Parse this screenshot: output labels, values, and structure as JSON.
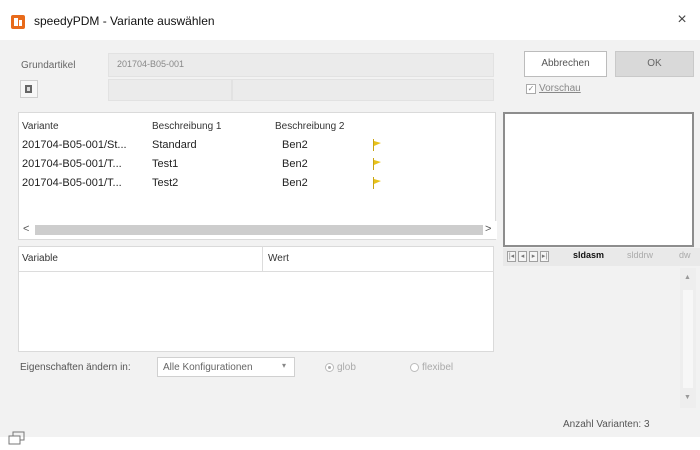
{
  "window": {
    "title": "speedyPDM - Variante auswählen",
    "close_glyph": "×",
    "app_icon": "speedypdm-logo-icon"
  },
  "grundartikel": {
    "label": "Grundartikel",
    "value": "201704-B05-001"
  },
  "buttons": {
    "cancel": "Abbrechen",
    "ok": "OK"
  },
  "preview_checkbox": {
    "label": "Vorschau",
    "checked": true
  },
  "variants_list": {
    "headers": [
      "Variante",
      "Beschreibung 1",
      "Beschreibung 2"
    ],
    "rows": [
      {
        "variante": "201704-B05-001/St...",
        "beschreibung1": "Standard",
        "beschreibung2": "Ben2"
      },
      {
        "variante": "201704-B05-001/T...",
        "beschreibung1": "Test1",
        "beschreibung2": "Ben2"
      },
      {
        "variante": "201704-B05-001/T...",
        "beschreibung1": "Test2",
        "beschreibung2": "Ben2"
      }
    ],
    "scroll_left": "<",
    "scroll_right": ">"
  },
  "properties_grid": {
    "headers": [
      "Variable",
      "Wert"
    ]
  },
  "bottom_bar": {
    "label": "Eigenschaften ändern in:",
    "select_value": "Alle Konfigurationen",
    "radio_1": "glob",
    "radio_2": "flexibel"
  },
  "preview_tabs": {
    "tabs": [
      "sldasm",
      "slddrw",
      "dw"
    ],
    "active_index": 0
  },
  "status": {
    "text": "Anzahl Varianten: 3"
  },
  "colors": {
    "dialog_bg": "#f2f2f2",
    "flag_yellow": "#e8c21a",
    "logo_orange": "#e86a1a"
  }
}
